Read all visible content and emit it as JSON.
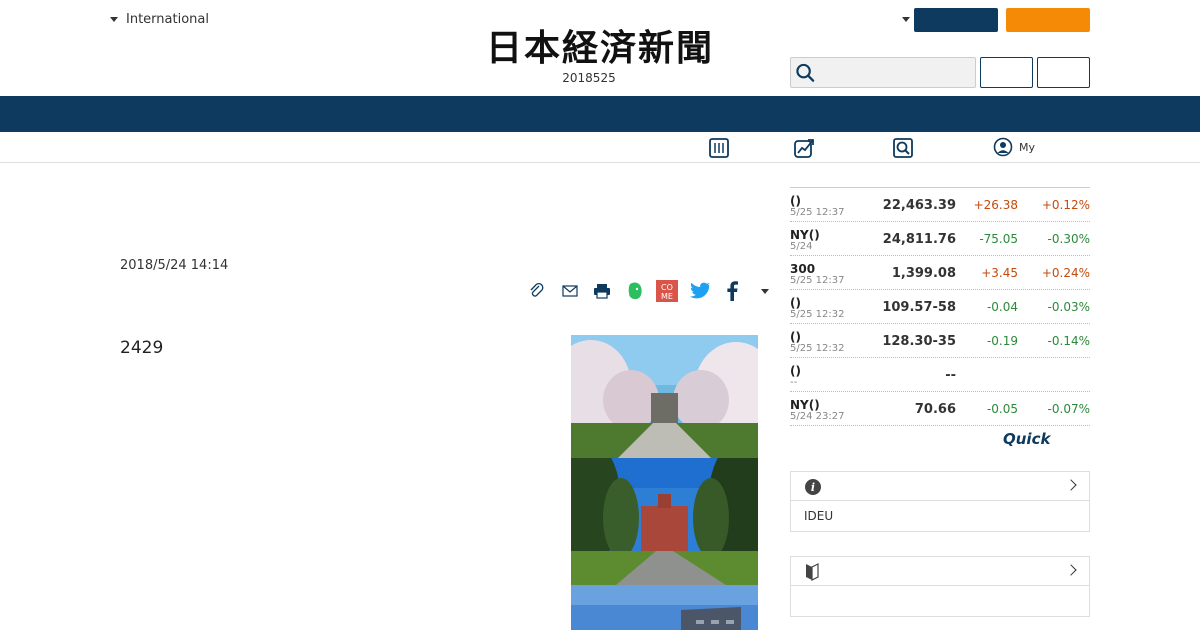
{
  "header": {
    "edition_label": "International",
    "logo_text": "日本経済新聞",
    "date_text": "2018525",
    "search_placeholder": ""
  },
  "subnav": {
    "my_label": "My"
  },
  "article": {
    "date": "2018/5/24 14:14",
    "lead_text": "2429"
  },
  "market": {
    "rows": [
      {
        "name": "()",
        "time": "5/25 12:37",
        "value": "22,463.39",
        "change": "+26.38",
        "pct": "+0.12%",
        "dir": "up"
      },
      {
        "name": "NY()",
        "time": "5/24",
        "value": "24,811.76",
        "change": "-75.05",
        "pct": "-0.30%",
        "dir": "down"
      },
      {
        "name": "300",
        "time": "5/25 12:37",
        "value": "1,399.08",
        "change": "+3.45",
        "pct": "+0.24%",
        "dir": "up"
      },
      {
        "name": "()",
        "time": "5/25 12:32",
        "value": "109.57-58",
        "change": "-0.04",
        "pct": "-0.03%",
        "dir": "down"
      },
      {
        "name": "()",
        "time": "5/25 12:32",
        "value": "128.30-35",
        "change": "-0.19",
        "pct": "-0.14%",
        "dir": "down"
      },
      {
        "name": "()",
        "time": "--",
        "value": "--",
        "change": "",
        "pct": "",
        "dir": "none"
      },
      {
        "name": "NY()",
        "time": "5/24 23:27",
        "value": "70.66",
        "change": "-0.05",
        "pct": "-0.07%",
        "dir": "down"
      }
    ],
    "provider": "Quick"
  },
  "boxes": [
    {
      "icon": "info-icon",
      "body": "IDEU"
    },
    {
      "icon": "beginner-icon",
      "body": ""
    }
  ],
  "colors": {
    "navy": "#0d3a5e",
    "orange": "#f58a07",
    "up": "#c54a0c",
    "down": "#2a8a3a"
  }
}
